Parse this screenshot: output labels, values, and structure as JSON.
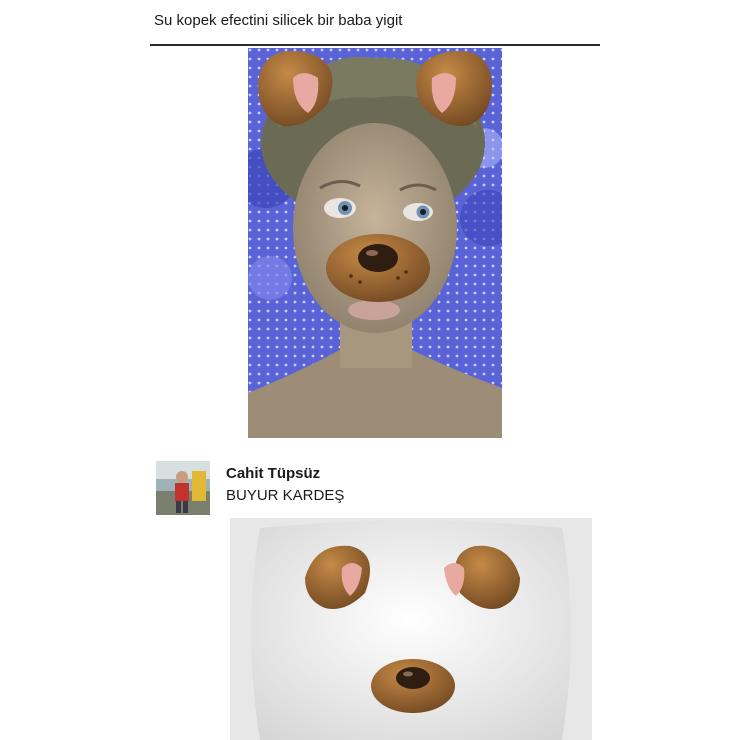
{
  "post": {
    "title": "Su kopek efectini silicek bir baba yigit"
  },
  "comment": {
    "author": "Cahit Tüpsüz",
    "text": "BUYUR KARDEŞ"
  },
  "icons": {
    "avatar": "user-photo",
    "filter": "dog-filter"
  },
  "colors": {
    "background": "#ffffff",
    "text": "#1b1b1b",
    "divider": "#2b2b2b",
    "ear_brown": "#8a5a2b",
    "ear_pink": "#e8a9a0",
    "pillow_blue": "#5a63d6"
  }
}
